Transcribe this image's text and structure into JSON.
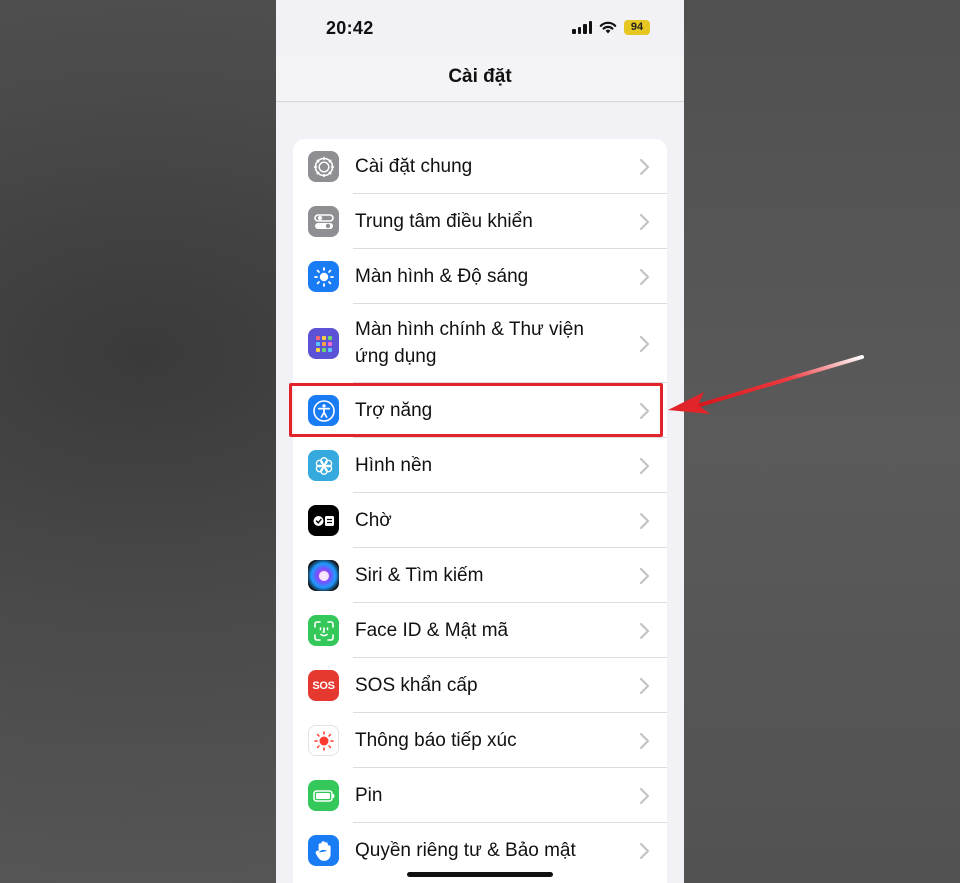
{
  "status_bar": {
    "time": "20:42",
    "battery": "94"
  },
  "header": {
    "title": "Cài đặt"
  },
  "settings": [
    {
      "label": "Cài đặt chung",
      "icon": "gear-icon",
      "color": "#8e8e93"
    },
    {
      "label": "Trung tâm điều khiển",
      "icon": "toggles-icon",
      "color": "#8e8e93"
    },
    {
      "label": "Màn hình & Độ sáng",
      "icon": "brightness-icon",
      "color": "#1a7cf5"
    },
    {
      "label_line1": "Màn hình chính & Thư viện",
      "label_line2": "ứng dụng",
      "icon": "app-grid-icon",
      "color": "#5b52d6"
    },
    {
      "label": "Trợ năng",
      "icon": "accessibility-icon",
      "color": "#1a7cf5"
    },
    {
      "label": "Hình nền",
      "icon": "wallpaper-flower-icon",
      "color": "#36aade"
    },
    {
      "label": "Chờ",
      "icon": "standby-icon",
      "color": "#000000"
    },
    {
      "label": "Siri & Tìm kiếm",
      "icon": "siri-icon",
      "color": "#222222"
    },
    {
      "label": "Face ID & Mật mã",
      "icon": "face-id-icon",
      "color": "#34c759"
    },
    {
      "label": "SOS khẩn cấp",
      "icon": "sos-icon",
      "color": "#e5382f",
      "icon_text": "SOS"
    },
    {
      "label": "Thông báo tiếp xúc",
      "icon": "exposure-notification-icon",
      "color": "#ffffff"
    },
    {
      "label": "Pin",
      "icon": "battery-icon",
      "color": "#34c759"
    },
    {
      "label": "Quyền riêng tư & Bảo mật",
      "icon": "hand-icon",
      "color": "#1a7cf5"
    }
  ],
  "annotation": {
    "highlight_color": "#e0242a"
  }
}
